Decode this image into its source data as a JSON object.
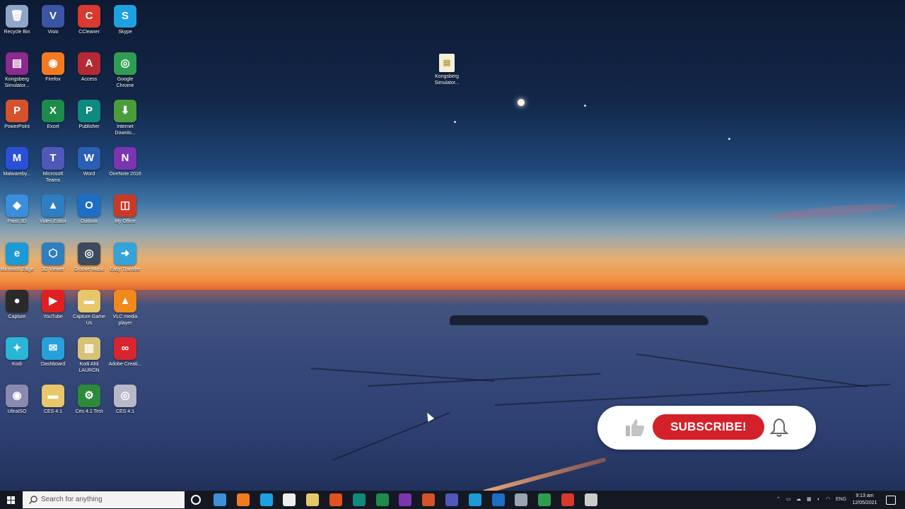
{
  "desktop": {
    "icons": [
      {
        "label": "Recycle Bin",
        "icon": "recycle-bin-icon",
        "glyph": "🗑",
        "color": "#8fa6c8"
      },
      {
        "label": "Visio",
        "icon": "visio-icon",
        "glyph": "V",
        "color": "#3955a3"
      },
      {
        "label": "CCleaner",
        "icon": "ccleaner-icon",
        "glyph": "C",
        "color": "#d83a2f"
      },
      {
        "label": "Skype",
        "icon": "skype-icon",
        "glyph": "S",
        "color": "#1ea1e0"
      },
      {
        "label": "Kongsberg Simulator...",
        "icon": "winrar-icon",
        "glyph": "▤",
        "color": "#8b2a8f"
      },
      {
        "label": "Firefox",
        "icon": "firefox-icon",
        "glyph": "◉",
        "color": "#f27b22"
      },
      {
        "label": "Access",
        "icon": "access-icon",
        "glyph": "A",
        "color": "#b42a34"
      },
      {
        "label": "Google Chrome",
        "icon": "chrome-icon",
        "glyph": "◎",
        "color": "#2f9d51"
      },
      {
        "label": "PowerPoint",
        "icon": "powerpoint-icon",
        "glyph": "P",
        "color": "#d4532d"
      },
      {
        "label": "Excel",
        "icon": "excel-icon",
        "glyph": "X",
        "color": "#1e8a4c"
      },
      {
        "label": "Publisher",
        "icon": "publisher-icon",
        "glyph": "P",
        "color": "#0f8a7e"
      },
      {
        "label": "Internet Downlo...",
        "icon": "internet-download-manager-icon",
        "glyph": "⬇",
        "color": "#4a9d3a"
      },
      {
        "label": "Malwareby...",
        "icon": "malwarebytes-icon",
        "glyph": "M",
        "color": "#2950d6"
      },
      {
        "label": "Microsoft Teams",
        "icon": "teams-icon",
        "glyph": "T",
        "color": "#5058b9"
      },
      {
        "label": "Word",
        "icon": "word-icon",
        "glyph": "W",
        "color": "#2b5fb3"
      },
      {
        "label": "OneNote 2016",
        "icon": "onenote-icon",
        "glyph": "N",
        "color": "#7b35b0"
      },
      {
        "label": "Paint 3D",
        "icon": "paint3d-icon",
        "glyph": "◆",
        "color": "#3a8fdc"
      },
      {
        "label": "Video Editor",
        "icon": "video-editor-icon",
        "glyph": "▲",
        "color": "#2d7fc2"
      },
      {
        "label": "Outlook",
        "icon": "outlook-icon",
        "glyph": "O",
        "color": "#1d6fc4"
      },
      {
        "label": "My Office",
        "icon": "office-icon",
        "glyph": "◫",
        "color": "#c93a26"
      },
      {
        "label": "Microsoft Edge",
        "icon": "edge-icon",
        "glyph": "e",
        "color": "#1c9ad6"
      },
      {
        "label": "3D Viewer",
        "icon": "3d-viewer-icon",
        "glyph": "⬡",
        "color": "#2f7fbf"
      },
      {
        "label": "Groove Music",
        "icon": "groove-music-icon",
        "glyph": "◎",
        "color": "#3b4a5c"
      },
      {
        "label": "Easy Transfer",
        "icon": "transfer-icon",
        "glyph": "➜",
        "color": "#35a3d9"
      },
      {
        "label": "Capture",
        "icon": "capture-icon",
        "glyph": "●",
        "color": "#2a2a2a"
      },
      {
        "label": "YouTube",
        "icon": "youtube-icon",
        "glyph": "▶",
        "color": "#e02020"
      },
      {
        "label": "Capture Game Us",
        "icon": "folder-icon",
        "glyph": "▬",
        "color": "#e8c66a"
      },
      {
        "label": "VLC media player",
        "icon": "vlc-icon",
        "glyph": "▲",
        "color": "#f08a1c"
      },
      {
        "label": "Kodi",
        "icon": "kodi-icon",
        "glyph": "✦",
        "color": "#2ab5d6"
      },
      {
        "label": "Dashboard",
        "icon": "dashboard-icon",
        "glyph": "✉",
        "color": "#27a0dc"
      },
      {
        "label": "Kodi Ahli LAURON",
        "icon": "archive-icon",
        "glyph": "▥",
        "color": "#d8c27a"
      },
      {
        "label": "Adobe Creati...",
        "icon": "adobe-cc-icon",
        "glyph": "∞",
        "color": "#d8262e"
      },
      {
        "label": "UltraISO",
        "icon": "ultraiso-icon",
        "glyph": "◉",
        "color": "#8a8ab0"
      },
      {
        "label": "CES 4.1",
        "icon": "folder-icon",
        "glyph": "▬",
        "color": "#e8c66a"
      },
      {
        "label": "Ces 4.1 Test",
        "icon": "ces-test-icon",
        "glyph": "⚙",
        "color": "#2c8a3a"
      },
      {
        "label": "CES 4.1",
        "icon": "disc-icon",
        "glyph": "◎",
        "color": "#b8b8c8"
      }
    ],
    "floating_file": {
      "label": "Kongsberg Simulator...",
      "icon": "file-icon"
    }
  },
  "subscribe_badge": {
    "button_label": "SUBSCRIBE!",
    "thumb_icon": "thumbs-up-icon",
    "bell_icon": "bell-icon",
    "accent": "#d4202a"
  },
  "taskbar": {
    "search_placeholder": "Search for anything",
    "pinned": [
      {
        "name": "file-explorer-icon",
        "color": "#3f8fd9"
      },
      {
        "name": "firefox-icon",
        "color": "#f27b22"
      },
      {
        "name": "skype-icon",
        "color": "#1ea1e0"
      },
      {
        "name": "inkscape-icon",
        "color": "#eeeeee"
      },
      {
        "name": "folder-icon",
        "color": "#e8c66a"
      },
      {
        "name": "media-player-icon",
        "color": "#e0531e"
      },
      {
        "name": "publisher-icon",
        "color": "#0f8a7e"
      },
      {
        "name": "excel-icon",
        "color": "#1e8a4c"
      },
      {
        "name": "onenote-icon",
        "color": "#7b35b0"
      },
      {
        "name": "powerpoint-icon",
        "color": "#d4532d"
      },
      {
        "name": "teams-icon",
        "color": "#5058b9"
      },
      {
        "name": "edge-icon",
        "color": "#1c9ad6"
      },
      {
        "name": "outlook-icon",
        "color": "#1d6fc4"
      },
      {
        "name": "camera-icon",
        "color": "#9aa4b0"
      },
      {
        "name": "chrome-icon",
        "color": "#2f9d51"
      },
      {
        "name": "chrome-alt-icon",
        "color": "#d8392b"
      },
      {
        "name": "settings-icon",
        "color": "#cccccc"
      }
    ],
    "tray_language": "ENG",
    "clock_time": "9:13 am",
    "clock_date": "12/05/2021"
  }
}
